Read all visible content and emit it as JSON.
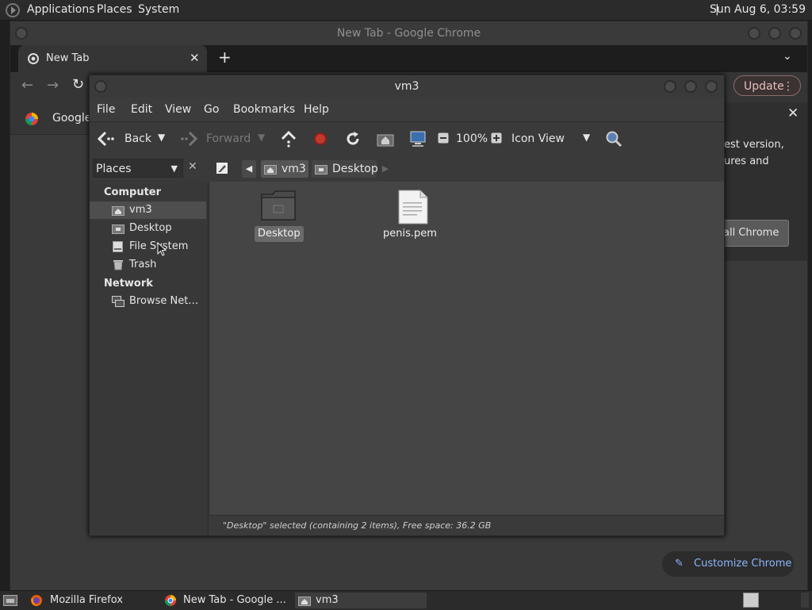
{
  "top_panel": {
    "menus": [
      "Applications",
      "Places",
      "System"
    ],
    "clock": "Sun Aug  6, 03:59"
  },
  "chrome": {
    "window_title": "New Tab - Google Chrome",
    "tab_label": "New Tab",
    "bookmark_label": "Google",
    "update_label": "Update",
    "popup_text_1": "est version,",
    "popup_text_2": "ures and",
    "install_label": "all Chrome",
    "customize_label": "Customize Chrome"
  },
  "nautilus": {
    "title": "vm3",
    "menu": {
      "file": "File",
      "edit": "Edit",
      "view": "View",
      "go": "Go",
      "bookmarks": "Bookmarks",
      "help": "Help"
    },
    "toolbar": {
      "back": "Back",
      "forward": "Forward",
      "zoom": "100%",
      "view_mode": "Icon View"
    },
    "places_label": "Places",
    "sidebar": {
      "computer_header": "Computer",
      "network_header": "Network",
      "items": [
        "vm3",
        "Desktop",
        "File System",
        "Trash"
      ],
      "network_items": [
        "Browse Net…"
      ]
    },
    "path": [
      "vm3",
      "Desktop"
    ],
    "files": [
      {
        "name": "Desktop",
        "type": "folder",
        "selected": true
      },
      {
        "name": "penis.pem",
        "type": "file",
        "selected": false
      }
    ],
    "status": "\"Desktop\" selected (containing 2 items), Free space: 36.2 GB"
  },
  "taskbar": {
    "tasks": [
      "Mozilla Firefox",
      "New Tab - Google ...",
      "vm3"
    ]
  }
}
